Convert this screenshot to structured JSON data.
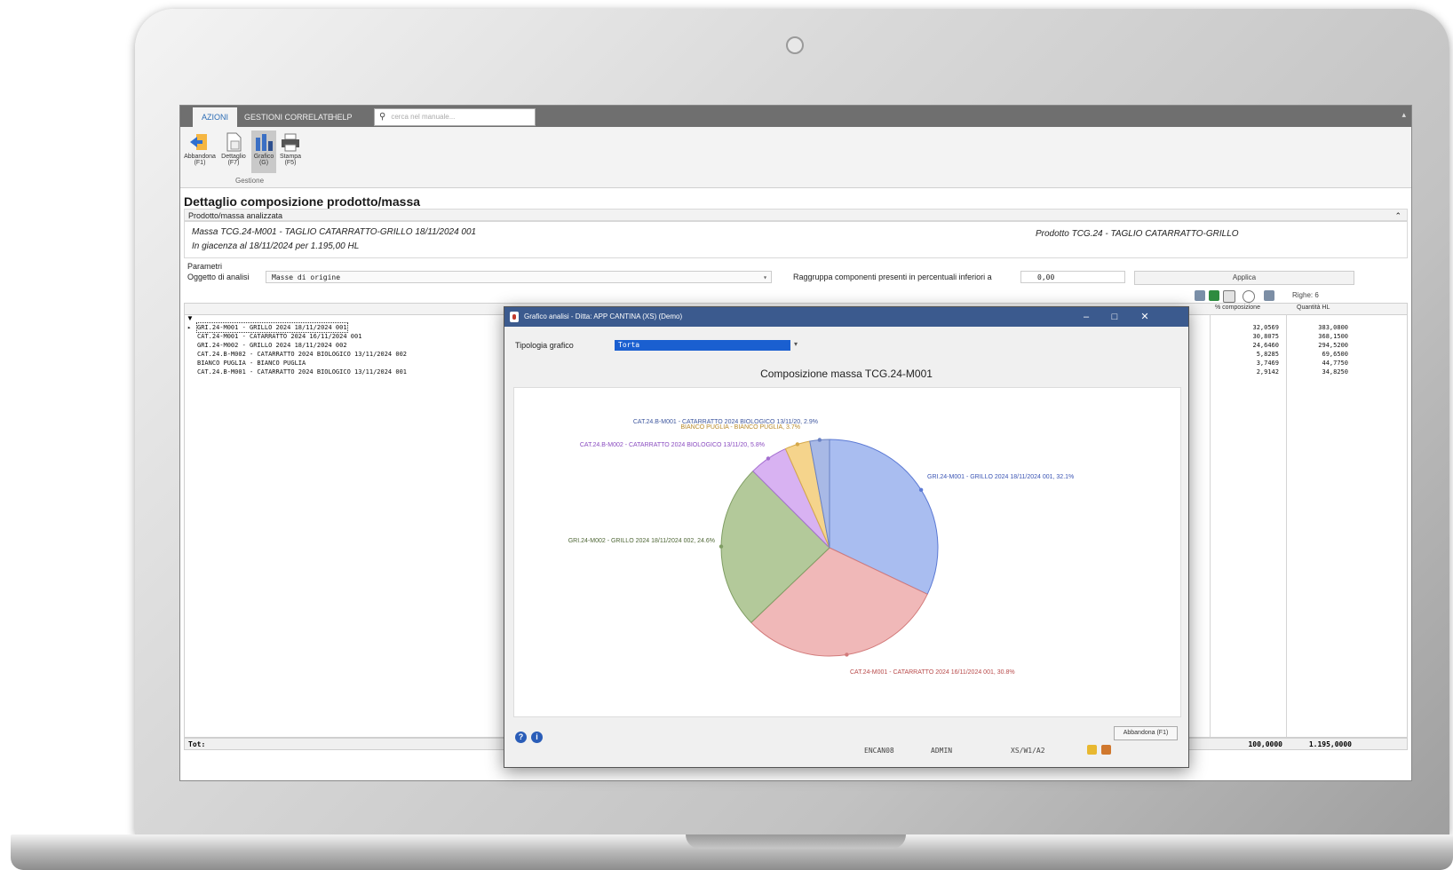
{
  "ribbon": {
    "tabs": [
      "AZIONI",
      "GESTIONI CORRELATE",
      "HELP"
    ],
    "search_placeholder": "cerca nel manuale...",
    "buttons": [
      {
        "label": "Abbandona",
        "key": "(F1)"
      },
      {
        "label": "Dettaglio",
        "key": "(F7)"
      },
      {
        "label": "Grafico",
        "key": "(G)"
      },
      {
        "label": "Stampa",
        "key": "(F5)"
      }
    ],
    "group_label": "Gestione"
  },
  "page": {
    "title": "Dettaglio composizione prodotto/massa",
    "section_product": "Prodotto/massa analizzata",
    "mass_line": "Massa TCG.24-M001 - TAGLIO CATARRATTO-GRILLO 18/11/2024 001",
    "stock_line": "In giacenza al 18/11/2024  per 1.195,00  HL",
    "product_line": "Prodotto TCG.24 - TAGLIO CATARRATTO-GRILLO",
    "section_params": "Parametri"
  },
  "params": {
    "object_label": "Oggetto di analisi",
    "object_value": "Masse di origine",
    "group_label": "Raggruppa componenti presenti in percentuali inferiori a",
    "threshold_value": "0,00",
    "apply_label": "Applica"
  },
  "grid": {
    "rows_count": "Righe: 6",
    "columns": {
      "pct": "% composizione",
      "qty": "Quantità HL"
    },
    "rows": [
      {
        "name": "GRI.24-M001 - GRILLO 2024 18/11/2024 001",
        "pct": "32,0569",
        "qty": "383,0800"
      },
      {
        "name": "CAT.24-M001 - CATARRATTO 2024 16/11/2024 001",
        "pct": "30,8075",
        "qty": "368,1500"
      },
      {
        "name": "GRI.24-M002 - GRILLO 2024 18/11/2024 002",
        "pct": "24,6460",
        "qty": "294,5200"
      },
      {
        "name": "CAT.24.B-M002 - CATARRATTO 2024 BIOLOGICO 13/11/2024 002",
        "pct": "5,8285",
        "qty": "69,6500"
      },
      {
        "name": "BIANCO PUGLIA - BIANCO PUGLIA",
        "pct": "3,7469",
        "qty": "44,7750"
      },
      {
        "name": "CAT.24.B-M001 - CATARRATTO 2024 BIOLOGICO 13/11/2024 001",
        "pct": "2,9142",
        "qty": "34,8250"
      }
    ],
    "total_label": "Tot:",
    "total_pct": "100,0000",
    "total_qty": "1.195,0000"
  },
  "dialog": {
    "title": "Grafico analisi - Ditta: APP CANTINA (XS) (Demo)",
    "chart_type_label": "Tipologia grafico",
    "chart_type_value": "Torta",
    "close_button": "Abbandona (F1)",
    "status": [
      "ENCAN08",
      "ADMIN",
      "XS/W1/A2"
    ]
  },
  "chart_data": {
    "type": "pie",
    "title": "Composizione massa TCG.24-M001",
    "slices": [
      {
        "label": "GRI.24-M001 - GRILLO 2024 18/11/2024 001, 32.1%",
        "value": 32.0569,
        "color": "#a9bdf0",
        "stroke": "#5b79d4",
        "text_color": "#3b55b4"
      },
      {
        "label": "CAT.24-M001 - CATARRATTO 2024 16/11/2024 001, 30.8%",
        "value": 30.8075,
        "color": "#f0b8b8",
        "stroke": "#d27a7a",
        "text_color": "#b84a4a"
      },
      {
        "label": "GRI.24-M002 - GRILLO 2024 18/11/2024 002, 24.6%",
        "value": 24.646,
        "color": "#b3c99a",
        "stroke": "#7f9d63",
        "text_color": "#4e6635"
      },
      {
        "label": "CAT.24.B-M002 - CATARRATTO 2024 BIOLOGICO 13/11/20, 5.8%",
        "value": 5.8285,
        "color": "#d8b2f2",
        "stroke": "#a46fd0",
        "text_color": "#8a4cc0"
      },
      {
        "label": "BIANCO PUGLIA - BIANCO PUGLIA, 3.7%",
        "value": 3.7469,
        "color": "#f5d48c",
        "stroke": "#d5a84a",
        "text_color": "#b88a2a"
      },
      {
        "label": "CAT.24.B-M001 - CATARRATTO 2024 BIOLOGICO 13/11/20, 2.9%",
        "value": 2.9142,
        "color": "#a8b9e6",
        "stroke": "#6a82c4",
        "text_color": "#3d569e"
      }
    ]
  }
}
